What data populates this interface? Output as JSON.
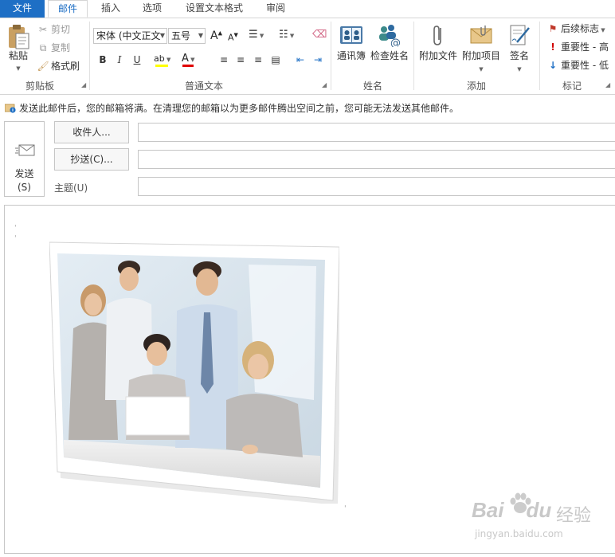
{
  "tabs": {
    "file": "文件",
    "mail": "邮件",
    "insert": "插入",
    "options": "选项",
    "format_text": "设置文本格式",
    "review": "审阅"
  },
  "ribbon": {
    "clipboard": {
      "label": "剪贴板",
      "paste": "粘贴",
      "cut": "剪切",
      "copy": "复制",
      "format_painter": "格式刷"
    },
    "basic_text": {
      "label": "普通文本",
      "font": "宋体 (中文正文",
      "size": "五号",
      "bold": "B",
      "italic": "I",
      "underline": "U",
      "grow": "A",
      "shrink": "A"
    },
    "names": {
      "label": "姓名",
      "address_book": "通讯簿",
      "check_names": "检查姓名"
    },
    "include": {
      "label": "添加",
      "attach_file": "附加文件",
      "attach_item": "附加项目",
      "signature": "签名"
    },
    "tags": {
      "label": "标记",
      "follow_up": "后续标志",
      "high_importance": "重要性 - 高",
      "low_importance": "重要性 - 低"
    }
  },
  "info_bar": {
    "message": "发送此邮件后，您的邮箱将满。在清理您的邮箱以为更多邮件腾出空间之前，您可能无法发送其他邮件。"
  },
  "compose": {
    "send_line1": "发送",
    "send_line2": "(S)",
    "to_button": "收件人...",
    "cc_button": "抄送(C)...",
    "subject_label": "主题(U)",
    "to_value": "",
    "cc_value": "",
    "subject_value": ""
  },
  "watermark": {
    "brand": "Bai",
    "brand2": "du",
    "jingyan": "经验",
    "url": "jingyan.baidu.com"
  },
  "colors": {
    "accent": "#1e6fc5",
    "highlight_yellow": "#ffff00",
    "font_red": "#e00000",
    "flag_red": "#c0392b",
    "importance_high": "#d00000",
    "importance_low": "#1e6fc5"
  }
}
